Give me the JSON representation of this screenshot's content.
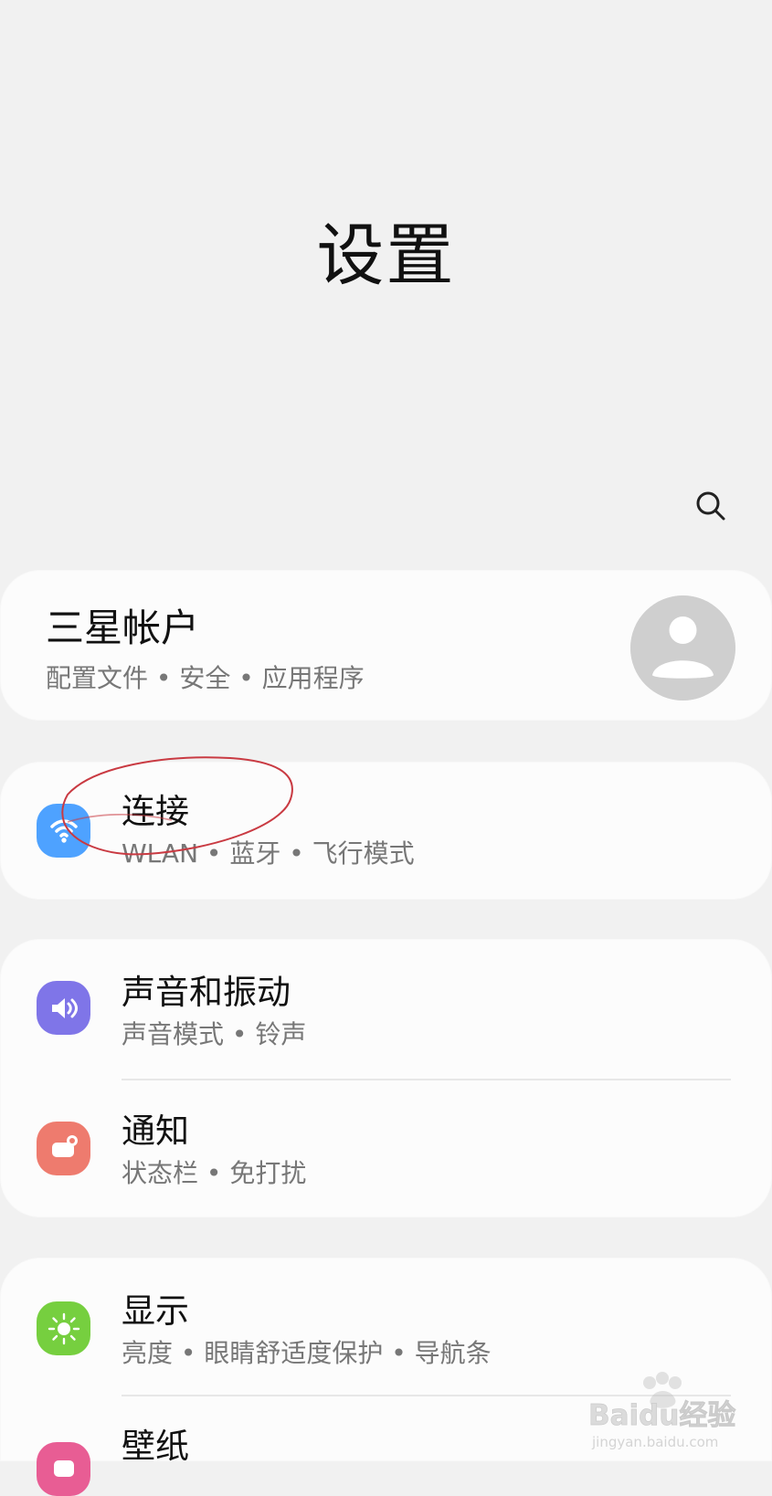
{
  "page": {
    "title": "设置"
  },
  "account": {
    "title": "三星帐户",
    "subtitle": "配置文件 • 安全 • 应用程序"
  },
  "items": [
    {
      "title": "连接",
      "subtitle": "WLAN • 蓝牙 • 飞行模式",
      "icon": "wifi-icon",
      "color": "#4ea2ff"
    },
    {
      "title": "声音和振动",
      "subtitle": "声音模式 • 铃声",
      "icon": "volume-icon",
      "color": "#7f75e8"
    },
    {
      "title": "通知",
      "subtitle": "状态栏 • 免打扰",
      "icon": "notification-icon",
      "color": "#ee7b6e"
    },
    {
      "title": "显示",
      "subtitle": "亮度 • 眼睛舒适度保护 • 导航条",
      "icon": "brightness-icon",
      "color": "#76cf3f"
    },
    {
      "title": "壁纸",
      "icon": "wallpaper-icon",
      "color": "#e85d94"
    }
  ],
  "watermark": {
    "logo_text": "Baidu经验",
    "url": "jingyan.baidu.com"
  },
  "colors": {
    "background": "#f1f1f1",
    "card": "#fcfcfc",
    "annotation": "#c93a42"
  }
}
